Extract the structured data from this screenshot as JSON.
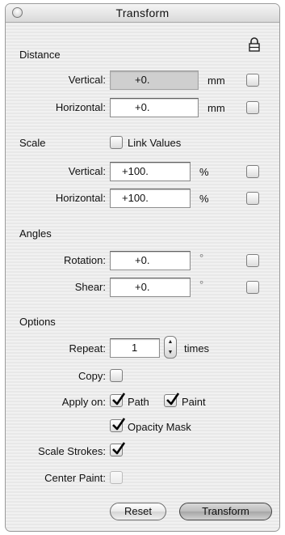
{
  "window": {
    "title": "Transform"
  },
  "distance": {
    "title": "Distance",
    "vertical": {
      "label": "Vertical:",
      "value": "+0.",
      "unit": "mm"
    },
    "horizontal": {
      "label": "Horizontal:",
      "value": "+0.",
      "unit": "mm"
    }
  },
  "scale": {
    "title": "Scale",
    "link_values_label": "Link Values",
    "vertical": {
      "label": "Vertical:",
      "value": "+100.",
      "unit": "%"
    },
    "horizontal": {
      "label": "Horizontal:",
      "value": "+100.",
      "unit": "%"
    }
  },
  "angles": {
    "title": "Angles",
    "rotation": {
      "label": "Rotation:",
      "value": "+0.",
      "unit": "°"
    },
    "shear": {
      "label": "Shear:",
      "value": "+0.",
      "unit": "°"
    }
  },
  "options": {
    "title": "Options",
    "repeat_label": "Repeat:",
    "repeat_value": "1",
    "repeat_unit": "times",
    "copy_label": "Copy:",
    "apply_on_label": "Apply on:",
    "path_label": "Path",
    "paint_label": "Paint",
    "opacity_mask_label": "Opacity Mask",
    "scale_strokes_label": "Scale Strokes:",
    "center_paint_label": "Center Paint:"
  },
  "buttons": {
    "reset": "Reset",
    "transform": "Transform"
  },
  "icons": {
    "lock": "lock-icon"
  }
}
